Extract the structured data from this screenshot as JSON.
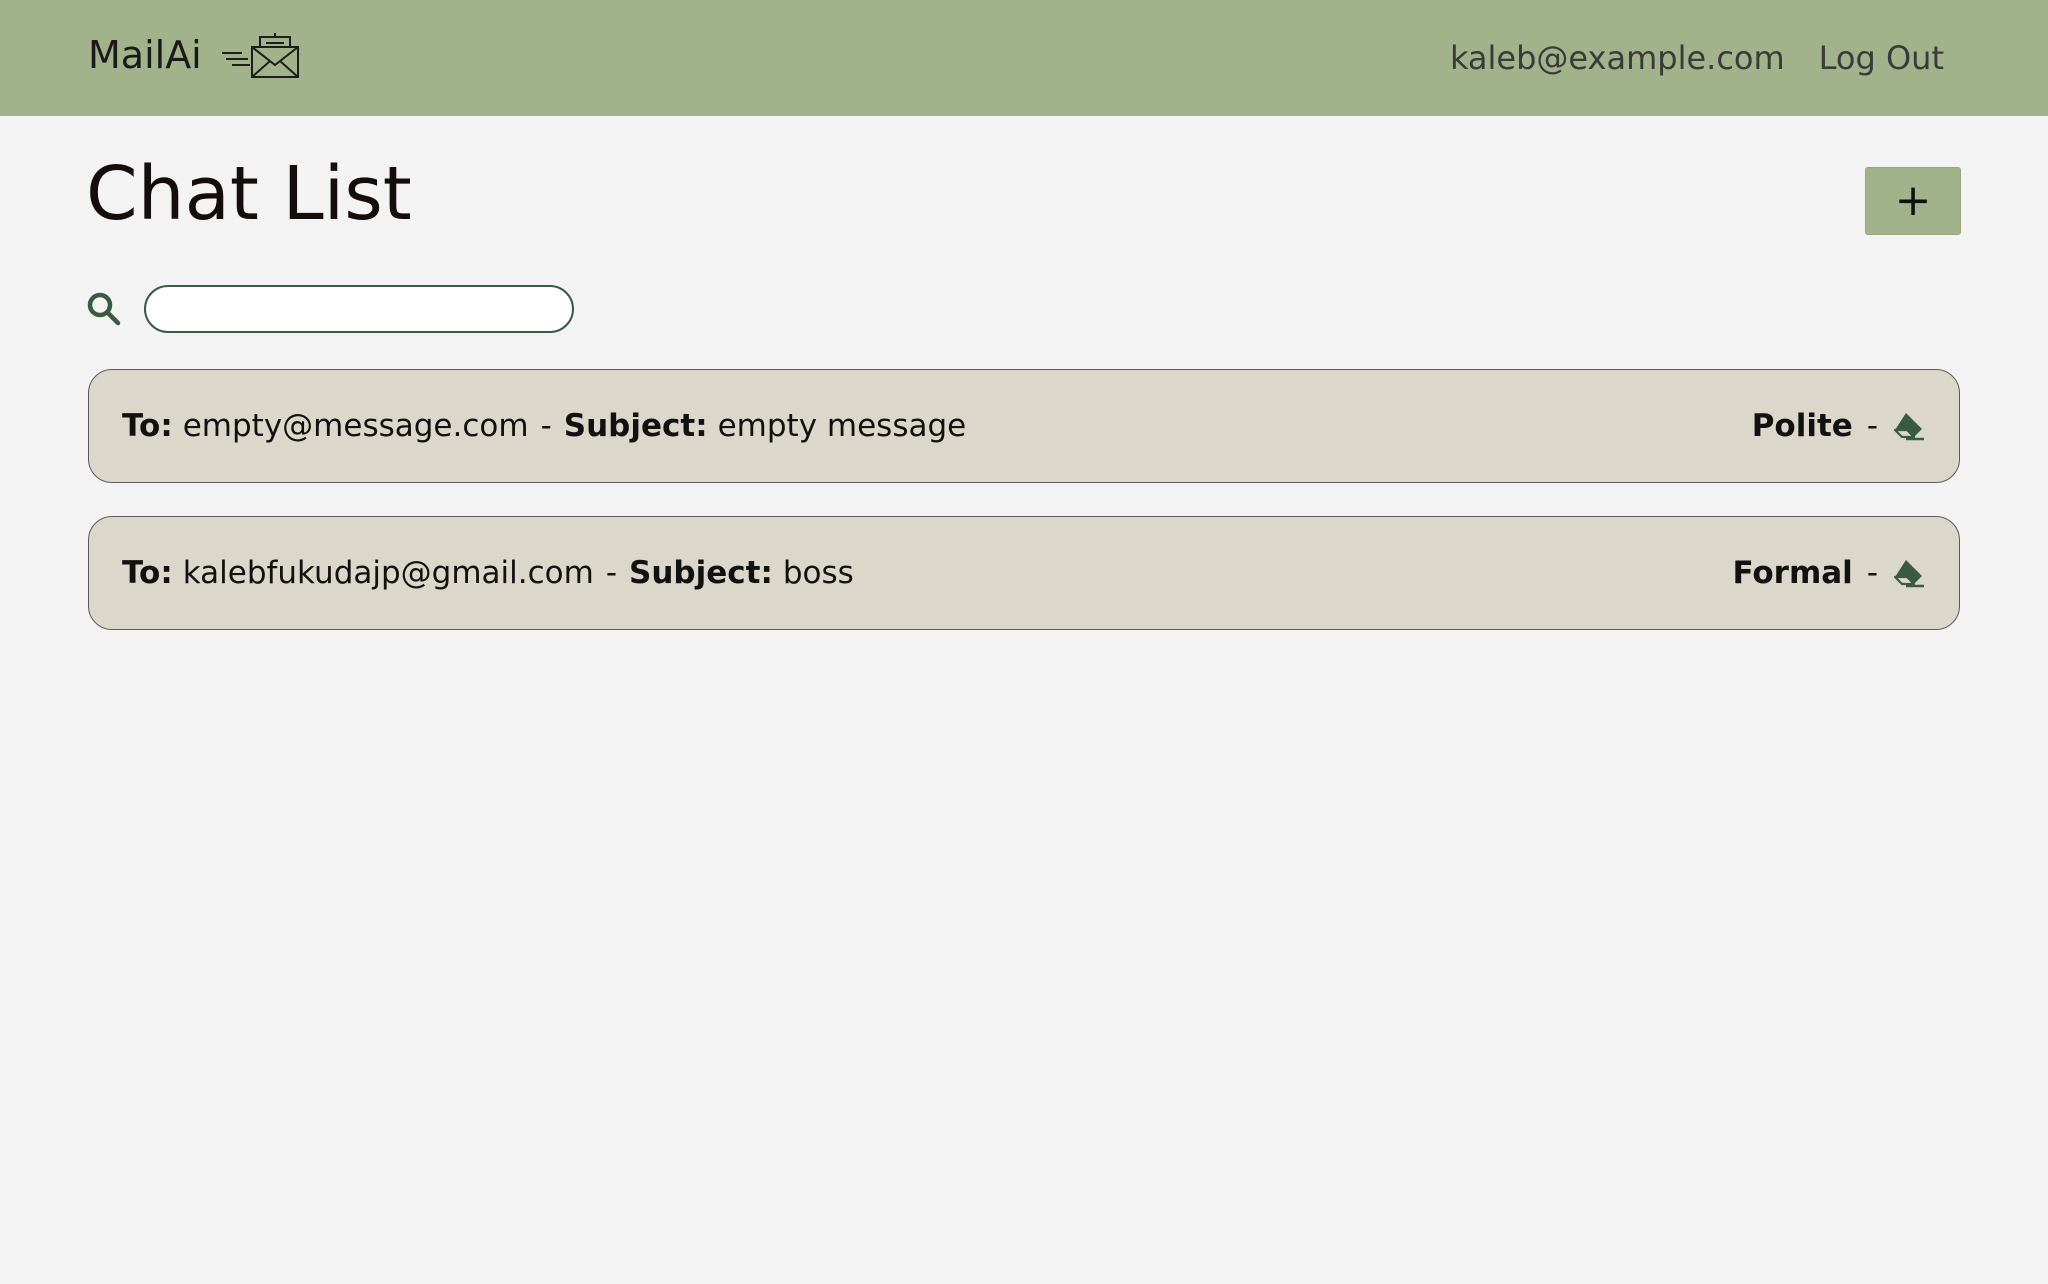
{
  "navbar": {
    "brand": "MailAi",
    "logo_icon": "envelope-mail-icon",
    "user_email": "kaleb@example.com",
    "logout_label": "Log Out"
  },
  "main": {
    "title": "Chat List",
    "add_label": "+",
    "search": {
      "icon": "search-icon",
      "placeholder": "",
      "value": ""
    },
    "chats": [
      {
        "to_label": "To:",
        "to": "empty@message.com",
        "separator": "-",
        "subject_label": "Subject:",
        "subject": "empty message",
        "tone": "Polite",
        "delete_icon": "eraser-icon"
      },
      {
        "to_label": "To:",
        "to": "kalebfukudajp@gmail.com",
        "separator": "-",
        "subject_label": "Subject:",
        "subject": "boss",
        "tone": "Formal",
        "delete_icon": "eraser-icon"
      }
    ]
  },
  "colors": {
    "navbar_bg": "#a2b28a",
    "page_bg": "#f3f3f3",
    "chat_item_bg": "#dbd8cb",
    "icon_green": "#3a5a42"
  }
}
